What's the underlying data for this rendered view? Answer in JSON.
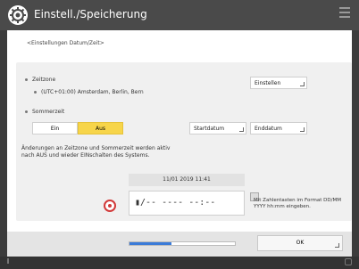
{
  "header": {
    "title": "Einstell./Speicherung"
  },
  "breadcrumb": "<Einstellungen Datum/Zeit>",
  "timezone": {
    "label": "Zeitzone",
    "value": "(UTC+01:00) Amsterdam, Berlin, Bern",
    "button": "Einstellen"
  },
  "summer": {
    "label": "Sommerzeit",
    "on_label": "Ein",
    "off_label": "Aus",
    "selected": "Aus",
    "start_button": "Startdatum",
    "end_button": "Enddatum"
  },
  "note": "Änderungen an Zeitzone und Sommerzeit werden aktiv nach AUS und wieder EINschalten des Systems.",
  "datetime": {
    "current": "11/01 2019 11:41",
    "input_value": "▮/-- ---- --:--"
  },
  "hint": "Mit Zahlentasten im Format DD/MM YYYY hh:mm eingeben.",
  "progress": {
    "value": 0.4
  },
  "ok_button": "OK",
  "colors": {
    "accent": "#f7d54a",
    "progress": "#3b7bd8",
    "clear": "#d23a3a"
  }
}
